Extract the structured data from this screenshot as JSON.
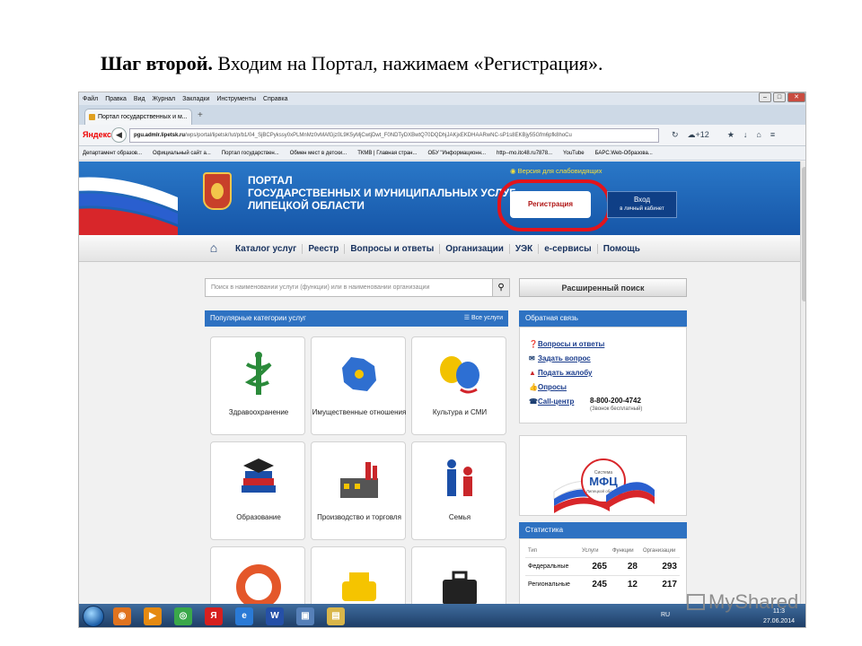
{
  "slide": {
    "title_bold": "Шаг второй.",
    "title_rest": " Входим на Портал, нажимаем «Регистрация»."
  },
  "browser": {
    "menu": [
      "Файл",
      "Правка",
      "Вид",
      "Журнал",
      "Закладки",
      "Инструменты",
      "Справка"
    ],
    "tab_title": "Портал государственных и м...",
    "new_tab": "+",
    "search_engine": "Яндекс",
    "url_host": "pgu.admlr.lipetsk.ru",
    "url_rest": "/wps/portal/lipetsk/!ut/p/b1/04_SjBCPykssy0xPLMnMz0vMAfGjz0L9K5yMjCwtjDwt_F0NDTyDXBwtQ70DQDhjJAKjxEKDHAARwNC-sP1s8EKBjy55Gfm6pfk8hoCu",
    "zoom": "+12",
    "bookmarks": [
      "Департамент образов...",
      "Официальный сайт а...",
      "Портал государствен...",
      "Обмен мест в детски...",
      "ТКМВ | Главная стран...",
      "ОБУ \"Информационн...",
      "http--mo.itc48.ru7878...",
      "YouTube",
      "БАРС.Web-Образова..."
    ]
  },
  "portal": {
    "title_lines": [
      "ПОРТАЛ",
      "ГОСУДАРСТВЕННЫХ И МУНИЦИПАЛЬНЫХ УСЛУГ",
      "ЛИПЕЦКОЙ ОБЛАСТИ"
    ],
    "weak_vision": "Версия для слабовидящих",
    "register": "Регистрация",
    "login": "Вход",
    "login_sub": "в личный кабинет",
    "nav": [
      "Каталог услуг",
      "Реестр",
      "Вопросы и ответы",
      "Организации",
      "УЭК",
      "e-сервисы",
      "Помощь"
    ],
    "search_placeholder": "Поиск в наименовании услуги (функции) или в наименовании организации",
    "advanced_search": "Расширенный поиск",
    "categories_title": "Популярные категории услуг",
    "all_services": "Все услуги",
    "categories": [
      "Здравоохранение",
      "Имущественные отношения",
      "Культура и СМИ",
      "Образование",
      "Производство и торговля",
      "Семья"
    ],
    "feedback_title": "Обратная связь",
    "feedback": [
      "Вопросы и ответы",
      "Задать вопрос",
      "Подать жалобу",
      "Опросы",
      "Call-центр"
    ],
    "phone": "8-800-200-4742",
    "phone_note": "(Звонок бесплатный)",
    "mfc_label": "МФЦ",
    "mfc_sub": "Система",
    "mfc_region": "Липецкой области",
    "stats_title": "Статистика",
    "stats_headers": [
      "Тип",
      "Услуги",
      "Функции",
      "Организации"
    ],
    "stats_rows": [
      [
        "Федеральные",
        "265",
        "28",
        "293"
      ],
      [
        "Региональные",
        "245",
        "12",
        "217"
      ]
    ]
  },
  "taskbar": {
    "lang": "RU",
    "time": "11:3",
    "date": "27.06.2014"
  },
  "watermark": "MyShared",
  "colors": {
    "portal_blue": "#1f66b8",
    "highlight_red": "#e2141c",
    "nav_text": "#17315e"
  }
}
